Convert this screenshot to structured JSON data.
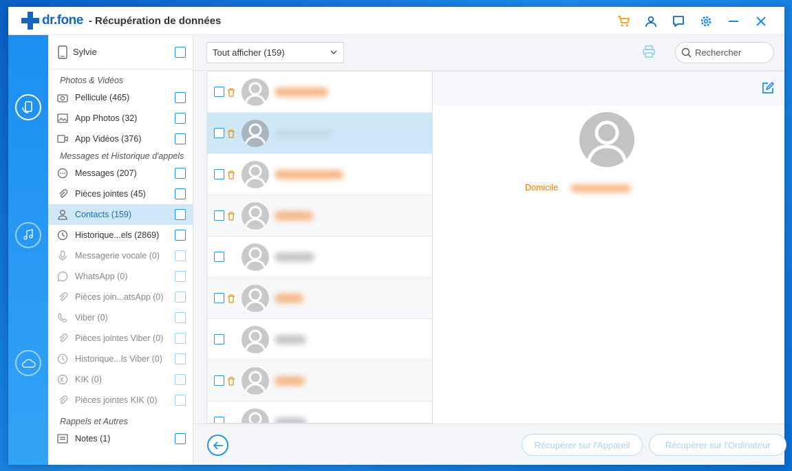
{
  "app": {
    "logo_text": "dr.fone",
    "title": "- Récupération de données"
  },
  "titlebar_icons": [
    "cart-icon",
    "user-icon",
    "feedback-icon",
    "settings-icon",
    "minimize-icon",
    "close-icon"
  ],
  "rail": [
    "phone-restore-icon",
    "music-restore-icon",
    "cloud-restore-icon"
  ],
  "device": {
    "name": "Sylvie"
  },
  "sections": {
    "photos": "Photos & Vidéos",
    "messages": "Messages et Historique d'appels",
    "reminders": "Rappels et Autres"
  },
  "categories": [
    {
      "label": "Pellicule (465)",
      "icon": "camera-icon"
    },
    {
      "label": "App Photos (32)",
      "icon": "image-icon"
    },
    {
      "label": "App Vidéos (376)",
      "icon": "video-icon"
    },
    {
      "label": "Messages (207)",
      "icon": "chat-icon"
    },
    {
      "label": "Pièces jointes (45)",
      "icon": "paperclip-icon"
    },
    {
      "label": "Contacts (159)",
      "icon": "contact-icon"
    },
    {
      "label": "Historique...els (2869)",
      "icon": "clock-icon"
    },
    {
      "label": "Messagerie vocale (0)",
      "icon": "microphone-icon"
    },
    {
      "label": "WhatsApp (0)",
      "icon": "whatsapp-icon"
    },
    {
      "label": "Pièces join...atsApp (0)",
      "icon": "paperclip-icon"
    },
    {
      "label": "Viber (0)",
      "icon": "viber-icon"
    },
    {
      "label": "Pièces jointes Viber (0)",
      "icon": "paperclip-icon"
    },
    {
      "label": "Historique...ls Viber (0)",
      "icon": "clock-icon"
    },
    {
      "label": "KIK (0)",
      "icon": "kik-icon"
    },
    {
      "label": "Pièces jointes KIK (0)",
      "icon": "paperclip-icon"
    },
    {
      "label": "Notes (1)",
      "icon": "notes-icon"
    }
  ],
  "toolbar": {
    "filter_selected": "Tout afficher (159)",
    "search_placeholder": "Rechercher"
  },
  "detail": {
    "field_label": "Domicile"
  },
  "footer": {
    "recover_device": "Récupérer sur l'Appareil",
    "recover_computer": "Récupérer sur l'Ordinateur"
  },
  "colors": {
    "accent": "#2196d8",
    "brand": "#1565c0",
    "selected_row": "#cfe8f8",
    "deleted_name": "#f6b98a",
    "orange": "#e07b17"
  }
}
